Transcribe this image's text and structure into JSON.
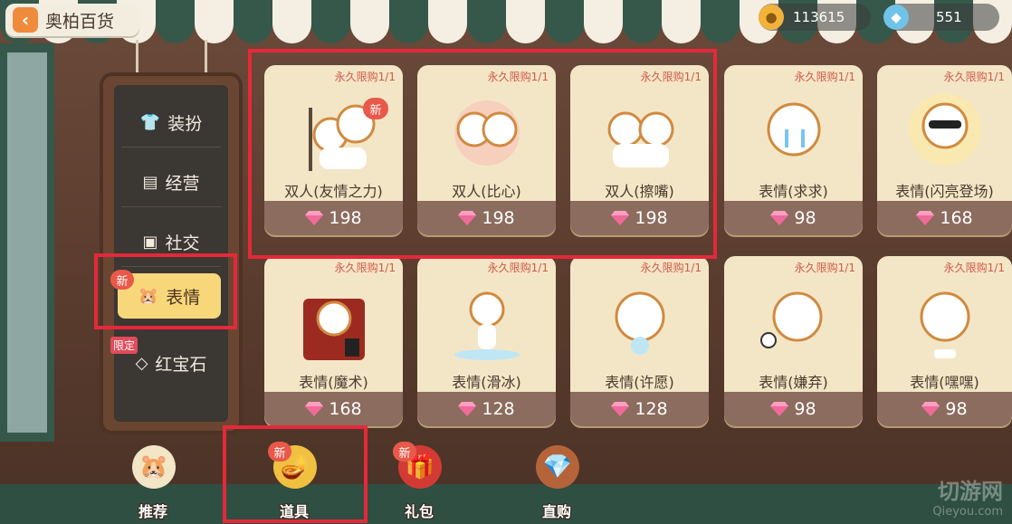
{
  "header": {
    "title": "奥柏百货",
    "back_icon": "chevron-left-icon",
    "currencies": [
      {
        "icon": "coin-icon",
        "value": "113615"
      },
      {
        "icon": "diamond-icon",
        "value": "551"
      }
    ]
  },
  "categories": [
    {
      "label": "装扮",
      "icon": "shirt-icon"
    },
    {
      "label": "经营",
      "icon": "register-icon"
    },
    {
      "label": "社交",
      "icon": "id-card-icon"
    },
    {
      "label": "表情",
      "icon": "hamster-face-icon",
      "badge": "新",
      "active": true
    },
    {
      "label": "红宝石",
      "icon": "ruby-icon",
      "badge": "限定"
    }
  ],
  "items": [
    {
      "limit": "永久限购1/1",
      "name": "双人(友情之力)",
      "price": "198",
      "badge": "新"
    },
    {
      "limit": "永久限购1/1",
      "name": "双人(比心)",
      "price": "198"
    },
    {
      "limit": "永久限购1/1",
      "name": "双人(擦嘴)",
      "price": "198"
    },
    {
      "limit": "永久限购1/1",
      "name": "表情(求求)",
      "price": "98"
    },
    {
      "limit": "永久限购1/1",
      "name": "表情(闪亮登场)",
      "price": "168"
    },
    {
      "limit": "永久限购1/1",
      "name": "表情(魔术)",
      "price": "168"
    },
    {
      "limit": "永久限购1/1",
      "name": "表情(滑冰)",
      "price": "128"
    },
    {
      "limit": "永久限购1/1",
      "name": "表情(许愿)",
      "price": "128"
    },
    {
      "limit": "永久限购1/1",
      "name": "表情(嫌弃)",
      "price": "98"
    },
    {
      "limit": "永久限购1/1",
      "name": "表情(嘿嘿)",
      "price": "98"
    }
  ],
  "bottom_tabs": [
    {
      "label": "推荐",
      "icon": "hamster-mascot-icon"
    },
    {
      "label": "道具",
      "icon": "lamp-icon",
      "badge": "新",
      "active": true
    },
    {
      "label": "礼包",
      "icon": "gift-box-icon",
      "badge": "新"
    },
    {
      "label": "直购",
      "icon": "treasure-chest-icon"
    }
  ],
  "watermark": {
    "big": "切游网",
    "small": "Qieyou.com"
  },
  "colors": {
    "highlight": "#e5283a",
    "price_bar": "#8b6c5e",
    "active_category": "#f8d77a"
  }
}
